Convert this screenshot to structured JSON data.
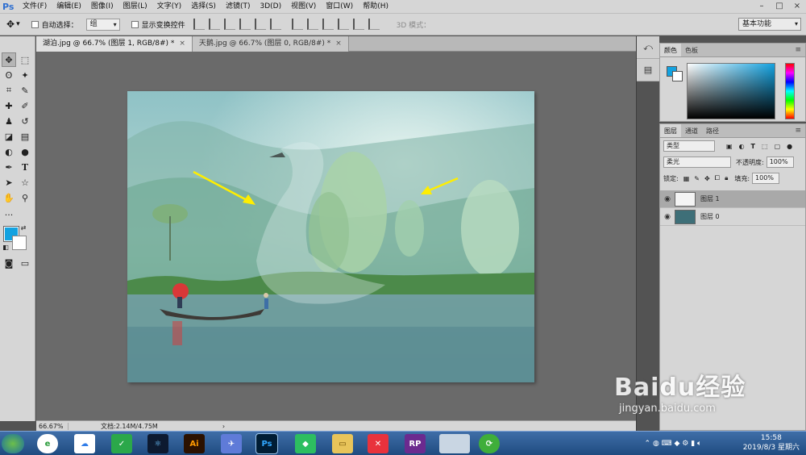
{
  "app": {
    "logo": "Ps"
  },
  "menus": [
    "文件(F)",
    "编辑(E)",
    "图像(I)",
    "图层(L)",
    "文字(Y)",
    "选择(S)",
    "滤镜(T)",
    "3D(D)",
    "视图(V)",
    "窗口(W)",
    "帮助(H)"
  ],
  "options": {
    "auto_select_label": "自动选择：",
    "auto_select_value": "组",
    "show_transform_label": "显示变换控件",
    "mode_3d_label": "3D 模式：",
    "workspace": "基本功能"
  },
  "tabs": [
    {
      "label": "湖泊.jpg @ 66.7% (图层 1, RGB/8#) *",
      "close": "×"
    },
    {
      "label": "天鹅.jpg @ 66.7% (图层 0, RGB/8#) *",
      "close": "×"
    }
  ],
  "status": {
    "zoom": "66.67%",
    "doc": "文档:2.14M/4.75M"
  },
  "color_panel": {
    "tabs": [
      "颜色",
      "色板"
    ],
    "fg_color": "#13a2e0",
    "bg_color": "#ffffff"
  },
  "layers_panel": {
    "tabs": [
      "图层",
      "通道",
      "路径"
    ],
    "filter": "类型",
    "blend_mode": "柔光",
    "opacity_label": "不透明度:",
    "opacity": "100%",
    "lock_label": "锁定:",
    "fill_label": "填充:",
    "fill": "100%",
    "layers": [
      {
        "name": "图层 1",
        "selected": true
      },
      {
        "name": "图层 0",
        "selected": false
      }
    ]
  },
  "taskbar": {
    "time": "15:58",
    "date": "2019/8/3 星期六",
    "apps": [
      "Ai",
      "Ps",
      "RP"
    ]
  },
  "watermark": {
    "brand": "Baidu经验",
    "url": "jingyan.baidu.com"
  }
}
